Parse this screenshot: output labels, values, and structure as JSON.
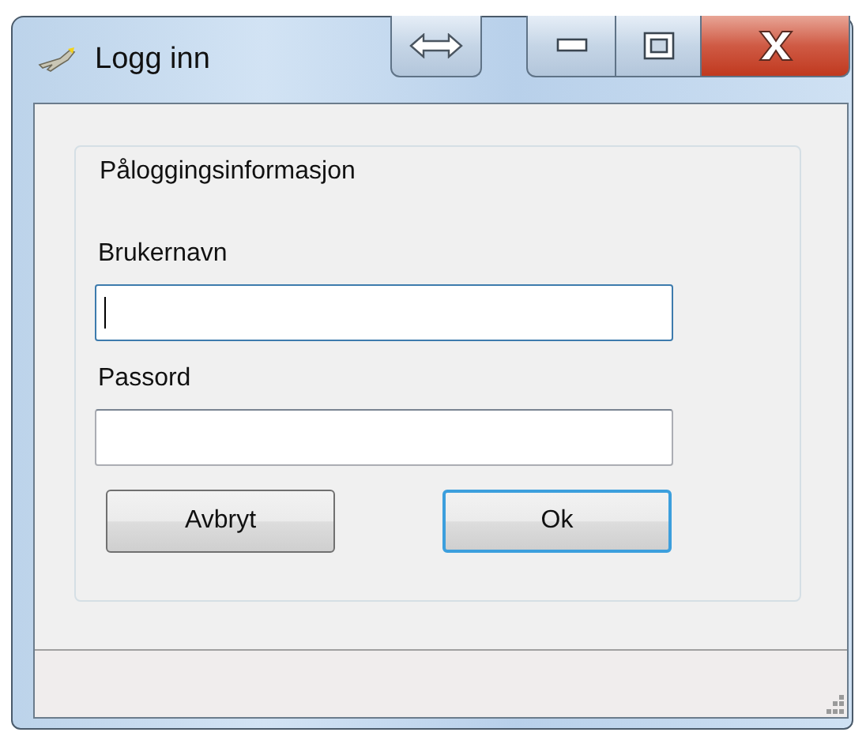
{
  "window": {
    "title": "Logg inn",
    "caption_buttons": [
      {
        "kind": "resize"
      },
      {
        "kind": "minimize"
      },
      {
        "kind": "maximize"
      },
      {
        "kind": "close"
      }
    ]
  },
  "group": {
    "legend": "Påloggingsinformasjon",
    "fields": [
      {
        "label": "Brukernavn",
        "focused": true
      },
      {
        "label": "Passord",
        "focused": false
      }
    ],
    "buttons": [
      {
        "label": "Avbryt",
        "default": false
      },
      {
        "label": "Ok",
        "default": true
      }
    ]
  },
  "status_bar": {
    "size_grip": true
  }
}
